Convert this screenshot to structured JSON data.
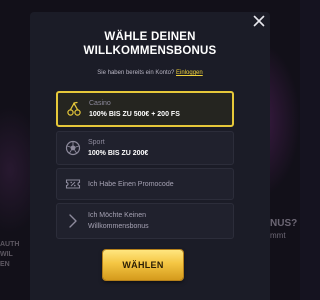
{
  "background": {
    "left_text": [
      "AUTH",
      "WIL",
      "EN"
    ],
    "right_text": [
      "NUS?",
      "mmt"
    ]
  },
  "modal": {
    "title_line1": "WÄHLE DEINEN",
    "title_line2": "WILLKOMMENSBONUS",
    "login_prompt": "Sie haben bereits ein Konto?",
    "login_link": "Einloggen",
    "close_icon": "close-icon",
    "options": [
      {
        "icon": "cherries-icon",
        "label": "Casino",
        "value": "100% BIS ZU 500€ + 200 FS",
        "selected": true
      },
      {
        "icon": "soccer-ball-icon",
        "label": "Sport",
        "value": "100% BIS ZU 200€",
        "selected": false
      },
      {
        "icon": "ticket-percent-icon",
        "text": "Ich Habe Einen Promocode"
      },
      {
        "icon": "chevron-right-icon",
        "text_line1": "Ich Möchte Keinen",
        "text_line2": "Willkommensbonus"
      }
    ],
    "submit_label": "WÄHLEN"
  },
  "colors": {
    "accent": "#e6c83a",
    "modal_bg": "#1b1c27",
    "link": "#f1d23a"
  }
}
